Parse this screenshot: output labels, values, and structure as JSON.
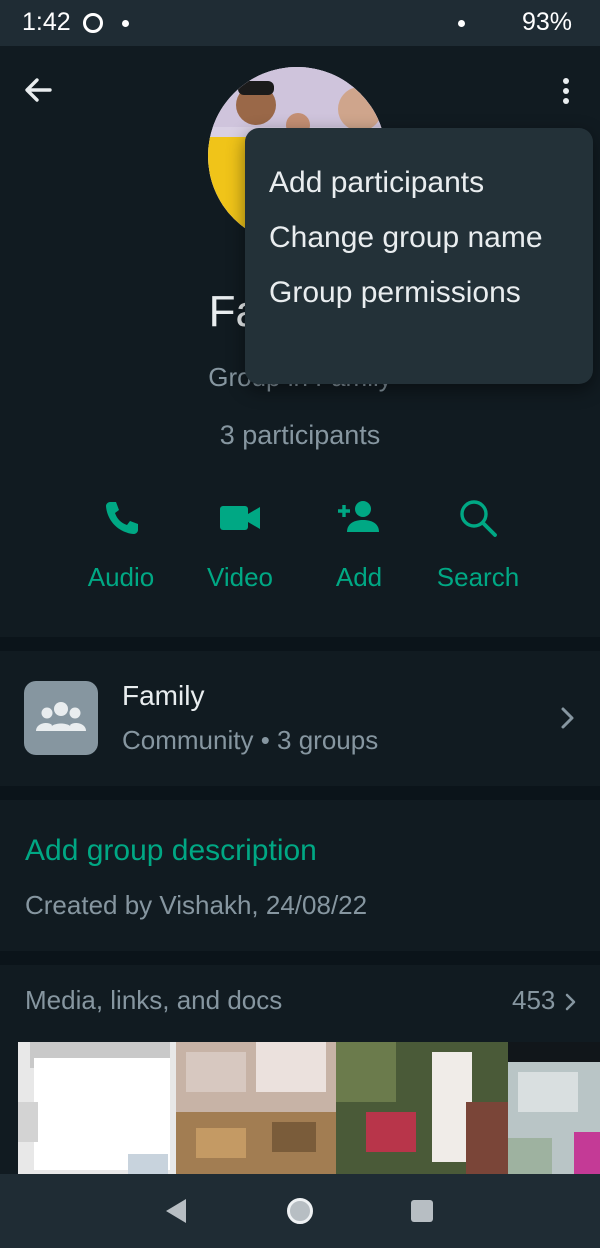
{
  "status_bar": {
    "time": "1:42",
    "battery": "93%"
  },
  "header": {
    "back_icon": "arrow-left-icon",
    "more_icon": "vertical-dots-icon"
  },
  "group": {
    "name": "Fa",
    "subtitle": "Group in Family",
    "participants": "3 participants"
  },
  "menu": {
    "items": [
      {
        "label": "Add participants"
      },
      {
        "label": "Change group name"
      },
      {
        "label": "Group permissions"
      }
    ]
  },
  "actions": [
    {
      "label": "Audio",
      "icon": "phone-icon"
    },
    {
      "label": "Video",
      "icon": "video-camera-icon"
    },
    {
      "label": "Add",
      "icon": "add-person-icon"
    },
    {
      "label": "Search",
      "icon": "search-icon"
    }
  ],
  "community": {
    "name": "Family",
    "meta": "Community • 3 groups"
  },
  "description": {
    "link": "Add group description",
    "created_by": "Created by Vishakh, 24/08/22"
  },
  "media": {
    "title": "Media, links, and docs",
    "count": "453"
  },
  "colors": {
    "background": "#111b21",
    "accent": "#00a884",
    "menu_background": "#233138",
    "secondary_text": "#8696a0"
  }
}
